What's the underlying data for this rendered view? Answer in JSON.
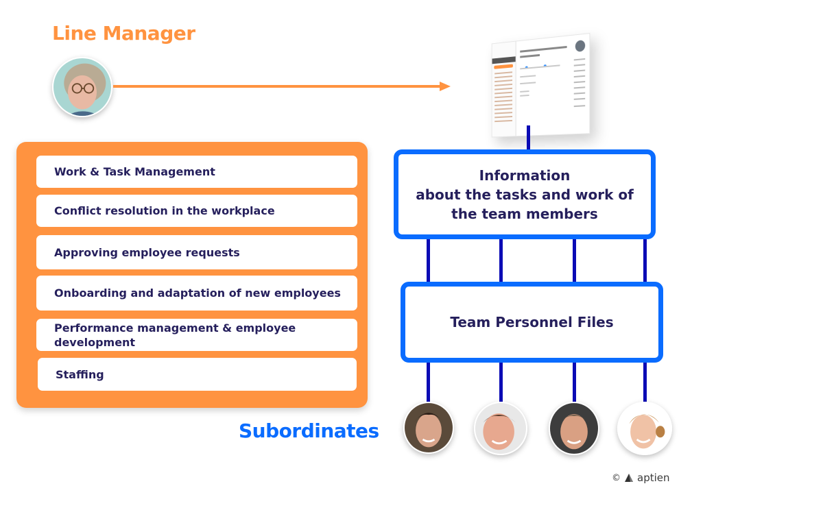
{
  "manager": {
    "title": "Line Manager",
    "avatar_label": "line-manager-photo"
  },
  "tasks": [
    "Work & Task Management",
    "Conflict resolution in the workplace",
    "Approving employee requests",
    "Onboarding and adaptation of new employees",
    "Performance management & employee development",
    "Staffing"
  ],
  "info_box": {
    "line1": "Information",
    "line2": "about the tasks and work of the team members"
  },
  "files_box": {
    "label": "Team Personnel Files"
  },
  "subordinates": {
    "title": "Subordinates",
    "count": 4
  },
  "footer": {
    "copyright_symbol": "©",
    "brand": "aptien"
  },
  "colors": {
    "orange": "#ff9340",
    "blue": "#0a6cff",
    "navy_line": "#0b0bb5",
    "text_dark": "#251f5c"
  }
}
